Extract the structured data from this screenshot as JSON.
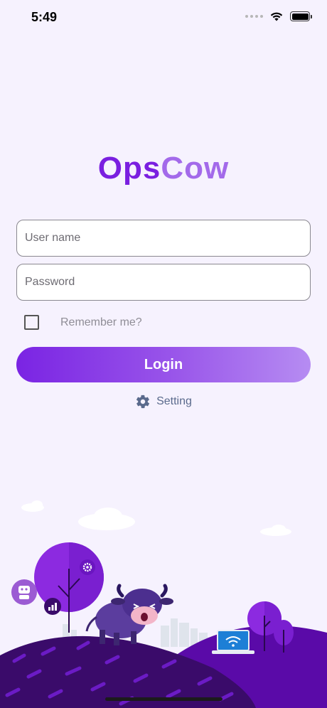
{
  "status": {
    "time": "5:49",
    "signal_icon": "signal-dots-icon",
    "wifi_icon": "wifi-icon",
    "battery_icon": "battery-icon",
    "battery_level": 1.0
  },
  "logo": {
    "part1": "Ops",
    "part2": "Cow",
    "color_primary": "#7a1fe0",
    "color_secondary": "#a36aea"
  },
  "login_form": {
    "username_placeholder": "User name",
    "username_value": "",
    "password_placeholder": "Password",
    "password_value": "",
    "remember_label": "Remember me?",
    "remember_checked": false,
    "login_label": "Login",
    "setting_label": "Setting",
    "setting_icon": "gear-icon"
  },
  "illustration": {
    "description_icons": [
      "robot-icon",
      "bar-chart-icon",
      "gear-icon",
      "wifi-laptop-icon",
      "cow-mascot",
      "tree-icon"
    ]
  },
  "colors": {
    "background": "#f6f2fe",
    "accent": "#7a24e3",
    "hill_dark": "#3a0b6a",
    "hill_purple": "#5a0aa8"
  }
}
